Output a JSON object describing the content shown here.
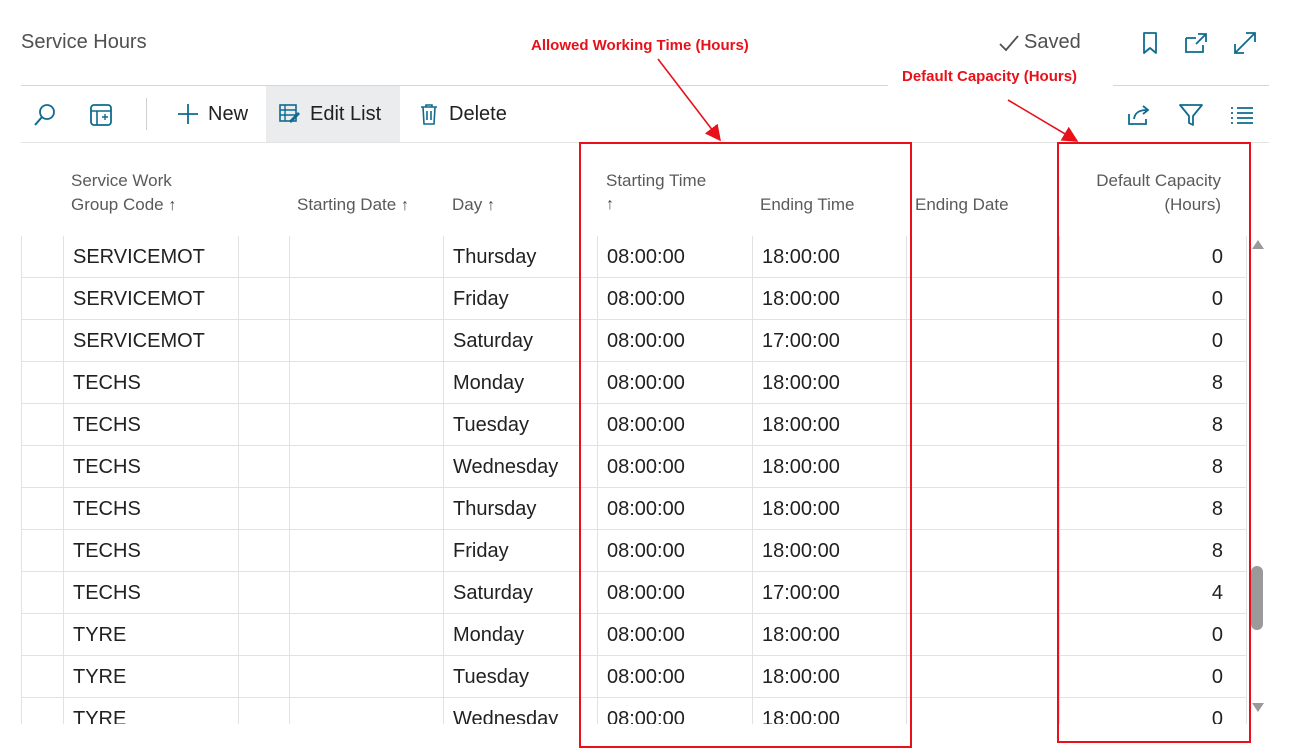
{
  "page": {
    "title": "Service Hours",
    "saved_label": "Saved"
  },
  "toolbar": {
    "new_label": "New",
    "edit_list_label": "Edit List",
    "delete_label": "Delete"
  },
  "columns": {
    "group_code_line1": "Service Work",
    "group_code_line2": "Group Code",
    "starting_date": "Starting Date",
    "day": "Day",
    "starting_time": "Starting Time",
    "ending_time": "Ending Time",
    "ending_date": "Ending Date",
    "capacity_line1": "Default Capacity",
    "capacity_line2": "(Hours)"
  },
  "rows": [
    {
      "code": "SERVICEMOT",
      "day": "Thursday",
      "start": "08:00:00",
      "end": "18:00:00",
      "capacity": "0"
    },
    {
      "code": "SERVICEMOT",
      "day": "Friday",
      "start": "08:00:00",
      "end": "18:00:00",
      "capacity": "0"
    },
    {
      "code": "SERVICEMOT",
      "day": "Saturday",
      "start": "08:00:00",
      "end": "17:00:00",
      "capacity": "0"
    },
    {
      "code": "TECHS",
      "day": "Monday",
      "start": "08:00:00",
      "end": "18:00:00",
      "capacity": "8"
    },
    {
      "code": "TECHS",
      "day": "Tuesday",
      "start": "08:00:00",
      "end": "18:00:00",
      "capacity": "8"
    },
    {
      "code": "TECHS",
      "day": "Wednesday",
      "start": "08:00:00",
      "end": "18:00:00",
      "capacity": "8"
    },
    {
      "code": "TECHS",
      "day": "Thursday",
      "start": "08:00:00",
      "end": "18:00:00",
      "capacity": "8"
    },
    {
      "code": "TECHS",
      "day": "Friday",
      "start": "08:00:00",
      "end": "18:00:00",
      "capacity": "8"
    },
    {
      "code": "TECHS",
      "day": "Saturday",
      "start": "08:00:00",
      "end": "17:00:00",
      "capacity": "4"
    },
    {
      "code": "TYRE",
      "day": "Monday",
      "start": "08:00:00",
      "end": "18:00:00",
      "capacity": "0"
    },
    {
      "code": "TYRE",
      "day": "Tuesday",
      "start": "08:00:00",
      "end": "18:00:00",
      "capacity": "0"
    },
    {
      "code": "TYRE",
      "day": "Wednesday",
      "start": "08:00:00",
      "end": "18:00:00",
      "capacity": "0"
    }
  ],
  "annotations": {
    "working_time": "Allowed Working Time (Hours)",
    "capacity": "Default Capacity (Hours)"
  },
  "colors": {
    "accent": "#0f6b8f",
    "annotation_red": "#e8111a",
    "toolbar_active_bg": "#eaecee"
  },
  "icons": [
    "search-icon",
    "layout-icon",
    "plus-icon",
    "edit-list-icon",
    "trash-icon",
    "checkmark-icon",
    "bookmark-icon",
    "open-new-window-icon",
    "expand-icon",
    "share-icon",
    "filter-icon",
    "list-icon"
  ]
}
